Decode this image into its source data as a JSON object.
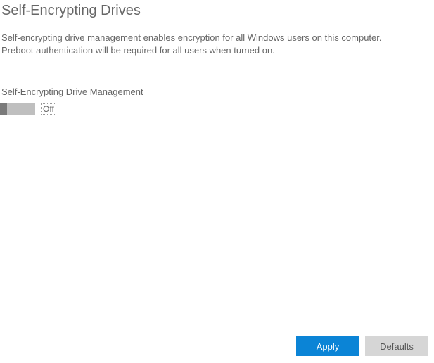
{
  "title": "Self-Encrypting Drives",
  "description": "Self-encrypting drive management enables encryption for all Windows users on this computer. Preboot authentication will be required for all users when turned on.",
  "section_label": "Self-Encrypting Drive Management",
  "toggle": {
    "state_label": "Off"
  },
  "buttons": {
    "apply": "Apply",
    "defaults": "Defaults"
  }
}
